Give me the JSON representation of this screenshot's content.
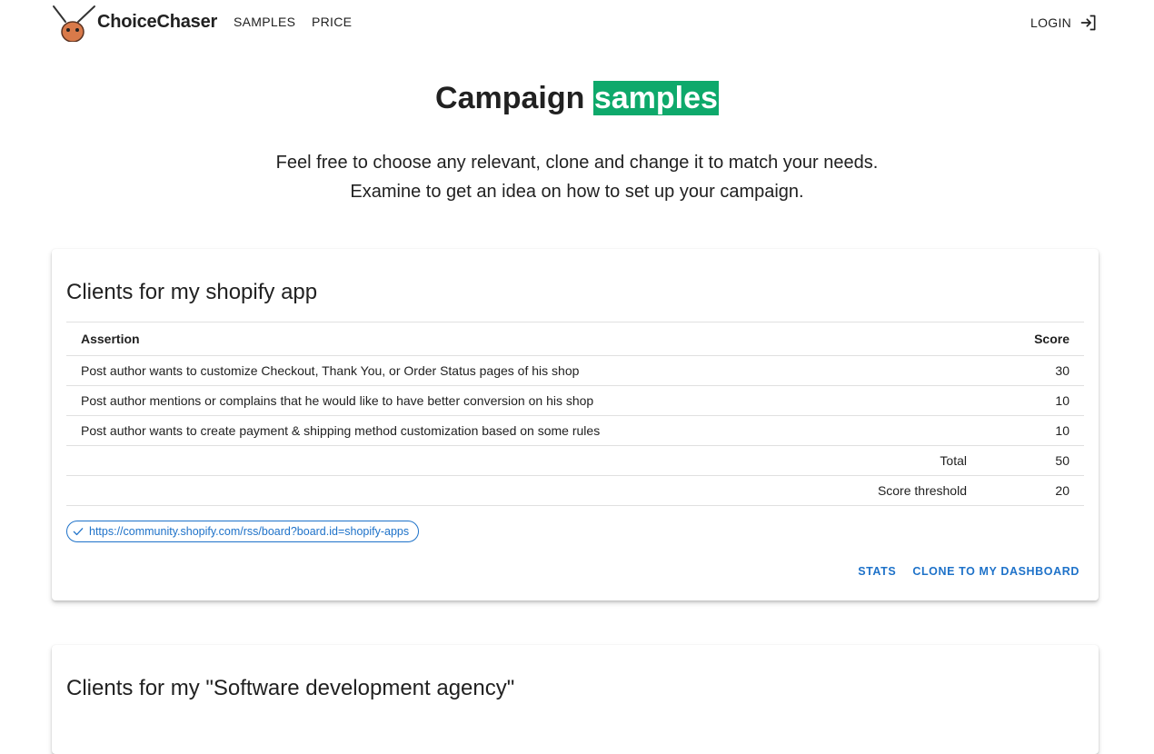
{
  "header": {
    "brand": "ChoiceChaser",
    "nav": {
      "samples": "SAMPLES",
      "price": "PRICE"
    },
    "login_label": "LOGIN"
  },
  "hero": {
    "title_plain": "Campaign",
    "title_highlight": "samples",
    "subtitle_line1": "Feel free to choose any relevant, clone and change it to match your needs.",
    "subtitle_line2": "Examine to get an idea on how to set up your campaign."
  },
  "campaigns": [
    {
      "title": "Clients for my shopify app",
      "table": {
        "headers": {
          "assertion": "Assertion",
          "score": "Score"
        },
        "rows": [
          {
            "assertion": "Post author wants to customize Checkout, Thank You, or Order Status pages of his shop",
            "score": "30"
          },
          {
            "assertion": "Post author mentions or complains that he would like to have better conversion on his shop",
            "score": "10"
          },
          {
            "assertion": "Post author wants to create payment & shipping method customization based on some rules",
            "score": "10"
          }
        ],
        "total_label": "Total",
        "total_value": "50",
        "threshold_label": "Score threshold",
        "threshold_value": "20"
      },
      "feed_url": "https://community.shopify.com/rss/board?board.id=shopify-apps",
      "actions": {
        "stats": "STATS",
        "clone": "CLONE TO MY DASHBOARD"
      }
    },
    {
      "title": "Clients for my \"Software development agency\""
    }
  ],
  "colors": {
    "accent_green": "#0ea96b",
    "link_blue": "#1e72c9",
    "text": "#212121"
  },
  "icons": {
    "login": "login-arrow-icon",
    "chip": "check-icon",
    "logo": "bug-logo-icon"
  }
}
